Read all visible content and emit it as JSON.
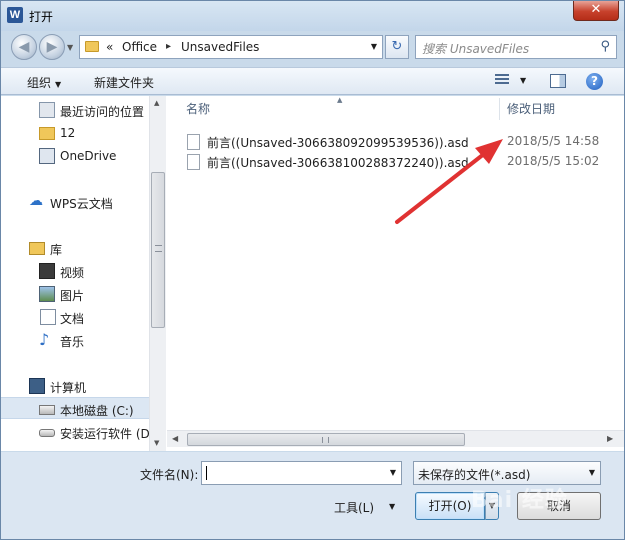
{
  "window": {
    "title": "打开",
    "app_icon": "W",
    "close_glyph": "✕"
  },
  "nav": {
    "back_glyph": "◀",
    "forward_glyph": "▶",
    "dropdown_glyph": "▼",
    "breadcrumb_prefix": "«",
    "path": [
      "Office",
      "UnsavedFiles"
    ],
    "separator": "▸",
    "refresh_glyph": "↻",
    "search_placeholder": "搜索 UnsavedFiles",
    "search_glyph": "⚲"
  },
  "toolbar": {
    "organize_label": "组织",
    "new_folder_label": "新建文件夹",
    "dropdown_glyph": "▼",
    "help_glyph": "?"
  },
  "sidebar": {
    "items": [
      {
        "label": "最近访问的位置"
      },
      {
        "label": "12"
      },
      {
        "label": "OneDrive"
      },
      {
        "label": "WPS云文档"
      },
      {
        "label": "库"
      },
      {
        "label": "视频"
      },
      {
        "label": "图片"
      },
      {
        "label": "文档"
      },
      {
        "label": "音乐"
      },
      {
        "label": "计算机"
      },
      {
        "label": "本地磁盘 (C:)"
      },
      {
        "label": "安装运行软件 (D"
      }
    ]
  },
  "filelist": {
    "columns": {
      "name": "名称",
      "modified": "修改日期"
    },
    "rows": [
      {
        "name": "前言((Unsaved-306638092099539536)).asd",
        "modified": "2018/5/5 14:58"
      },
      {
        "name": "前言((Unsaved-306638100288372240)).asd",
        "modified": "2018/5/5 15:02"
      }
    ]
  },
  "scroll": {
    "up": "▲",
    "down": "▼",
    "left": "◀",
    "right": "▶"
  },
  "bottom": {
    "filename_label": "文件名(N):",
    "filename_value": "",
    "filetype_value": "未保存的文件(*.asd)",
    "tools_label": "工具(L)",
    "open_label": "打开(O)",
    "cancel_label": "取消",
    "dropdown_glyph": "▼"
  },
  "colors": {
    "annotation_arrow": "#e03232",
    "accent": "#3c7fb1"
  }
}
